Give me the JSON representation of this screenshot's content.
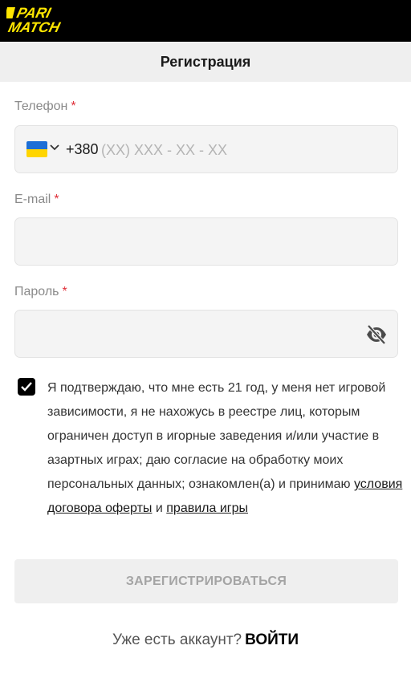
{
  "header": {
    "logo_text_top": "PARI",
    "logo_text_bottom": "MATCH",
    "logo_color": "#ffe600",
    "background": "#000000"
  },
  "page_title": "Регистрация",
  "form": {
    "phone": {
      "label": "Телефон",
      "required_mark": "*",
      "country_icon": "ukraine-flag-icon",
      "prefix": "+380",
      "placeholder": "(XX) XXX - XX - XX",
      "value": ""
    },
    "email": {
      "label": "E-mail",
      "required_mark": "*",
      "value": ""
    },
    "password": {
      "label": "Пароль",
      "required_mark": "*",
      "value": "",
      "toggle_icon": "eye-slash-icon"
    },
    "consent": {
      "checked": true,
      "text": "Я подтверждаю, что мне есть 21 год, у меня нет игровой зависимости, я не нахожусь в реестре лиц, которым ограничен доступ в игорные заведения и/или участие в азартных играх; даю согласие на обработку моих персональных данных; ознакомлен(а) и принимаю ",
      "link_terms": "условия договора оферты",
      "conjunction": " и ",
      "link_rules": "правила игры"
    },
    "submit_label": "ЗАРЕГИСТРИРОВАТЬСЯ"
  },
  "footer": {
    "question": "Уже есть аккаунт?",
    "login_label": "ВОЙТИ"
  },
  "colors": {
    "required": "#e0303a",
    "accent": "#ffe600"
  }
}
